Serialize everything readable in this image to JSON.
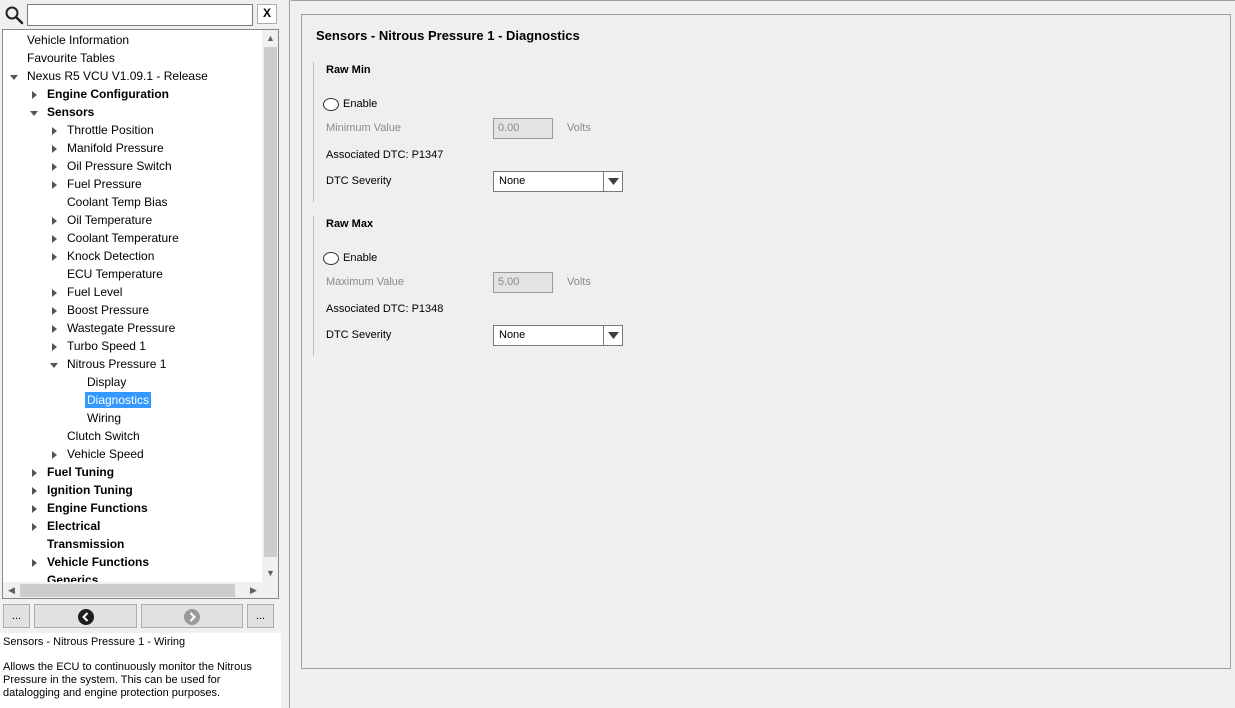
{
  "search": {
    "value": "",
    "clear_label": "X"
  },
  "tree": {
    "items": [
      {
        "label": "Vehicle Information",
        "level": 0,
        "arrow": "none",
        "bold": false
      },
      {
        "label": "Favourite Tables",
        "level": 0,
        "arrow": "none",
        "bold": false
      },
      {
        "label": "Nexus R5 VCU V1.09.1 - Release",
        "level": 0,
        "arrow": "expanded",
        "bold": false
      },
      {
        "label": "Engine Configuration",
        "level": 1,
        "arrow": "collapsed",
        "bold": true
      },
      {
        "label": "Sensors",
        "level": 1,
        "arrow": "expanded",
        "bold": true
      },
      {
        "label": "Throttle Position",
        "level": 2,
        "arrow": "collapsed",
        "bold": false
      },
      {
        "label": "Manifold Pressure",
        "level": 2,
        "arrow": "collapsed",
        "bold": false
      },
      {
        "label": "Oil Pressure Switch",
        "level": 2,
        "arrow": "collapsed",
        "bold": false
      },
      {
        "label": "Fuel Pressure",
        "level": 2,
        "arrow": "collapsed",
        "bold": false
      },
      {
        "label": "Coolant Temp Bias",
        "level": 2,
        "arrow": "none",
        "bold": false
      },
      {
        "label": "Oil Temperature",
        "level": 2,
        "arrow": "collapsed",
        "bold": false
      },
      {
        "label": "Coolant Temperature",
        "level": 2,
        "arrow": "collapsed",
        "bold": false
      },
      {
        "label": "Knock Detection",
        "level": 2,
        "arrow": "collapsed",
        "bold": false
      },
      {
        "label": "ECU Temperature",
        "level": 2,
        "arrow": "none",
        "bold": false
      },
      {
        "label": "Fuel Level",
        "level": 2,
        "arrow": "collapsed",
        "bold": false
      },
      {
        "label": "Boost Pressure",
        "level": 2,
        "arrow": "collapsed",
        "bold": false
      },
      {
        "label": "Wastegate Pressure",
        "level": 2,
        "arrow": "collapsed",
        "bold": false
      },
      {
        "label": "Turbo Speed 1",
        "level": 2,
        "arrow": "collapsed",
        "bold": false
      },
      {
        "label": "Nitrous Pressure 1",
        "level": 2,
        "arrow": "expanded",
        "bold": false
      },
      {
        "label": "Display",
        "level": 3,
        "arrow": "none",
        "bold": false
      },
      {
        "label": "Diagnostics",
        "level": 3,
        "arrow": "none",
        "bold": false,
        "selected": true
      },
      {
        "label": "Wiring",
        "level": 3,
        "arrow": "none",
        "bold": false
      },
      {
        "label": "Clutch Switch",
        "level": 2,
        "arrow": "none",
        "bold": false
      },
      {
        "label": "Vehicle Speed",
        "level": 2,
        "arrow": "collapsed",
        "bold": false
      },
      {
        "label": "Fuel Tuning",
        "level": 1,
        "arrow": "collapsed",
        "bold": true
      },
      {
        "label": "Ignition Tuning",
        "level": 1,
        "arrow": "collapsed",
        "bold": true
      },
      {
        "label": "Engine Functions",
        "level": 1,
        "arrow": "collapsed",
        "bold": true
      },
      {
        "label": "Electrical",
        "level": 1,
        "arrow": "collapsed",
        "bold": true
      },
      {
        "label": "Transmission",
        "level": 1,
        "arrow": "none",
        "bold": true
      },
      {
        "label": "Vehicle Functions",
        "level": 1,
        "arrow": "collapsed",
        "bold": true
      },
      {
        "label": "Generics",
        "level": 1,
        "arrow": "none",
        "bold": true
      }
    ]
  },
  "nav": {
    "more_left": "...",
    "more_right": "..."
  },
  "help": {
    "title": "Sensors - Nitrous Pressure 1 - Wiring",
    "text": "Allows the ECU to continuously monitor the Nitrous Pressure in the system. This can be used for datalogging and engine protection purposes."
  },
  "page": {
    "title": "Sensors - Nitrous Pressure 1 - Diagnostics",
    "raw_min": {
      "title": "Raw Min",
      "enable_label": "Enable",
      "value_label": "Minimum Value",
      "value": "0.00",
      "unit": "Volts",
      "dtc_label": "Associated DTC: P1347",
      "severity_label": "DTC Severity",
      "severity_value": "None"
    },
    "raw_max": {
      "title": "Raw Max",
      "enable_label": "Enable",
      "value_label": "Maximum Value",
      "value": "5.00",
      "unit": "Volts",
      "dtc_label": "Associated DTC: P1348",
      "severity_label": "DTC Severity",
      "severity_value": "None"
    }
  },
  "colors": {
    "selection": "#3399ff",
    "background": "#f0f0f0"
  }
}
